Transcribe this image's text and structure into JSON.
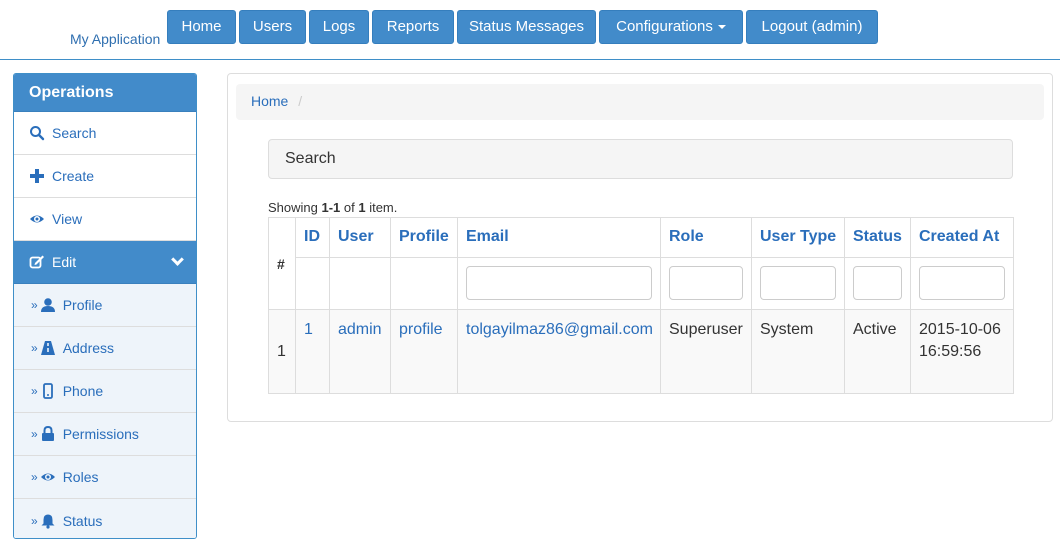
{
  "navbar": {
    "brand": "My Application",
    "items": [
      {
        "label": "Home"
      },
      {
        "label": "Users"
      },
      {
        "label": "Logs"
      },
      {
        "label": "Reports"
      },
      {
        "label": "Status Messages"
      },
      {
        "label": "Configurations"
      },
      {
        "label": "Logout (admin)"
      }
    ]
  },
  "sidebar": {
    "title": "Operations",
    "items": [
      {
        "label": "Search",
        "icon": "search-icon"
      },
      {
        "label": "Create",
        "icon": "plus-icon"
      },
      {
        "label": "View",
        "icon": "eye-icon"
      },
      {
        "label": "Edit",
        "icon": "edit-icon"
      },
      {
        "label": "Profile",
        "icon": "user-icon"
      },
      {
        "label": "Address",
        "icon": "road-icon"
      },
      {
        "label": "Phone",
        "icon": "phone-icon"
      },
      {
        "label": "Permissions",
        "icon": "lock-icon"
      },
      {
        "label": "Roles",
        "icon": "eye-icon"
      },
      {
        "label": "Status",
        "icon": "bell-icon"
      }
    ],
    "bullet": "»"
  },
  "breadcrumb": {
    "home": "Home",
    "separator": "/"
  },
  "search_panel": {
    "title": "Search"
  },
  "summary": {
    "prefix": "Showing ",
    "range": "1-1",
    "middle": " of ",
    "total": "1",
    "suffix": " item."
  },
  "table": {
    "headers": [
      "#",
      "ID",
      "User",
      "Profile",
      "Email",
      "Role",
      "User Type",
      "Status",
      "Created At"
    ],
    "rows": [
      {
        "num": "1",
        "id": "1",
        "user": "admin",
        "profile": "profile",
        "email": "tolgayilmaz86@gmail.com",
        "role": "Superuser",
        "user_type": "System",
        "status": "Active",
        "created_at": "2015-10-06 16:59:56"
      }
    ]
  },
  "colors": {
    "primary": "#428bca",
    "link": "#2a6ebb",
    "panel_bg": "#f5f5f5"
  }
}
